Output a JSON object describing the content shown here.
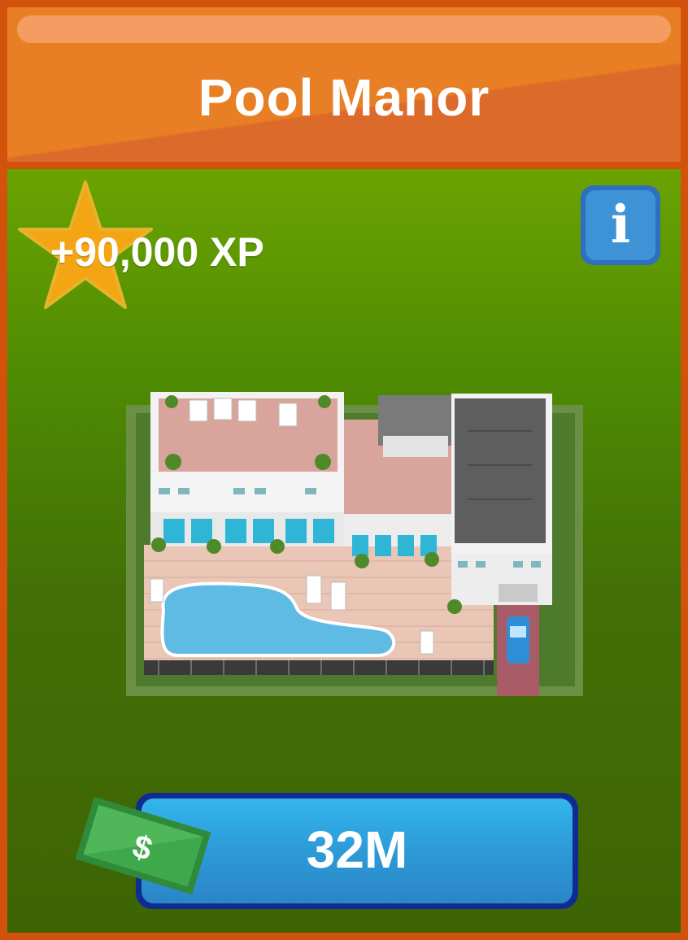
{
  "header": {
    "title": "Pool Manor"
  },
  "reward": {
    "xp_label": "+90,000 XP",
    "icon": "star-icon"
  },
  "info": {
    "glyph": "i",
    "icon": "info-icon"
  },
  "purchase": {
    "price": "32M",
    "currency_icon": "dollar-bill-icon",
    "currency_symbol": "$"
  },
  "item_image": {
    "name": "pool-manor-building"
  },
  "colors": {
    "frame": "#d2520b",
    "header": "#e97f24",
    "background_top": "#6ba302",
    "background_bottom": "#3e6403",
    "star": "#f3a514",
    "info_button": "#3e93d6",
    "buy_button": "#2d9ad8",
    "buy_button_border": "#0f2c95",
    "money": "#3fa84b"
  }
}
